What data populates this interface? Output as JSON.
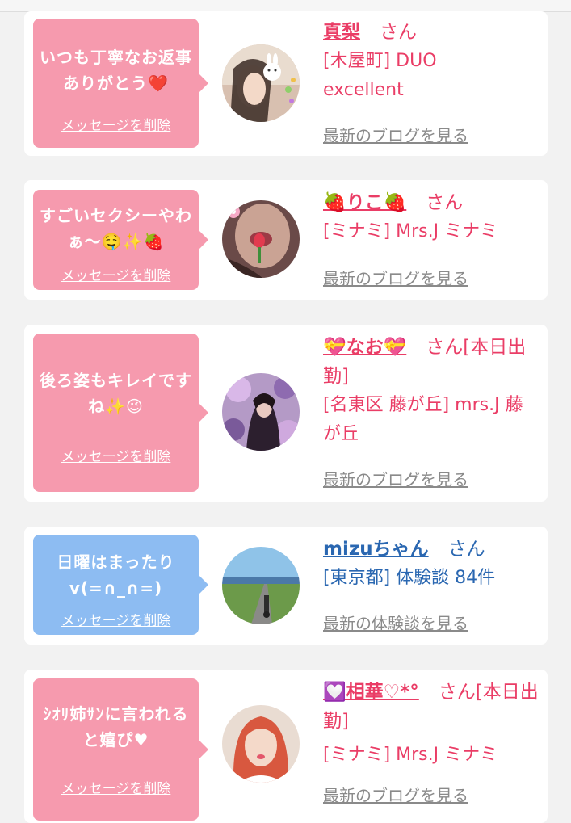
{
  "cards": [
    {
      "message": "いつも丁寧なお返事ありがとう❤️",
      "delete_label": "メッセージを削除",
      "name": "真梨",
      "honorific": "さん",
      "meta": "[木屋町] DUO excellent",
      "blog_link": "最新のブログを見る"
    },
    {
      "message": "すごいセクシーやわぁ〜🤤✨🍓",
      "delete_label": "メッセージを削除",
      "name": "🍓りこ🍓",
      "honorific": "さん",
      "meta": "[ミナミ] Mrs.J ミナミ",
      "blog_link": "最新のブログを見る"
    },
    {
      "message": "後ろ姿もキレイですね✨😉",
      "delete_label": "メッセージを削除",
      "name": "💝なお💝",
      "honorific": "さん[本日出勤]",
      "meta": "[名東区 藤が丘] mrs.J 藤が丘",
      "blog_link": "最新のブログを見る"
    },
    {
      "message": "日曜はまったりv(=∩_∩=)",
      "delete_label": "メッセージを削除",
      "name": "mizuちゃん",
      "honorific": "さん",
      "meta": "[東京都] 体験談 84件",
      "blog_link": "最新の体験談を見る"
    },
    {
      "message": "ｼｵﾘ姉ｻﾝに言われると嬉ぴ♥",
      "delete_label": "メッセージを削除",
      "name": "💟相華♡*°",
      "honorific": "さん[本日出勤]",
      "meta": "[ミナミ] Mrs.J ミナミ",
      "blog_link": "最新のブログを見る"
    }
  ],
  "colors": {
    "pink_bubble": "#f69aae",
    "blue_bubble": "#8dbcf2",
    "pink_text": "#ea3d66",
    "blue_text": "#2a67b1",
    "page_bg": "#f2f2f2"
  },
  "avatars": [
    "avatar-photo",
    "avatar-photo",
    "avatar-photo",
    "avatar-photo",
    "avatar-photo"
  ]
}
